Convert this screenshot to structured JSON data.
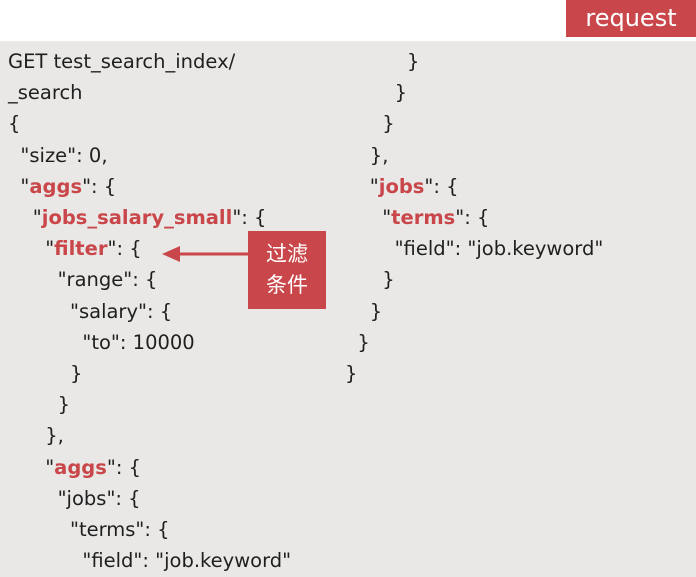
{
  "badge": "request",
  "callout": {
    "line1": "过滤",
    "line2": "条件"
  },
  "left_code": [
    [
      {
        "t": "GET test_search_index/"
      }
    ],
    [
      {
        "t": "_search"
      }
    ],
    [
      {
        "t": "{"
      }
    ],
    [
      {
        "t": "  \"size\": 0,"
      }
    ],
    [
      {
        "t": "  \""
      },
      {
        "t": "aggs",
        "k": true
      },
      {
        "t": "\": {"
      }
    ],
    [
      {
        "t": "    \""
      },
      {
        "t": "jobs_salary_small",
        "k": true
      },
      {
        "t": "\": {"
      }
    ],
    [
      {
        "t": "      \""
      },
      {
        "t": "filter",
        "k": true
      },
      {
        "t": "\": {"
      }
    ],
    [
      {
        "t": "        \"range\": {"
      }
    ],
    [
      {
        "t": "          \"salary\": {"
      }
    ],
    [
      {
        "t": "            \"to\": 10000"
      }
    ],
    [
      {
        "t": "          }"
      }
    ],
    [
      {
        "t": "        }"
      }
    ],
    [
      {
        "t": "      },"
      }
    ],
    [
      {
        "t": "      \""
      },
      {
        "t": "aggs",
        "k": true
      },
      {
        "t": "\": {"
      }
    ],
    [
      {
        "t": "        \"jobs\": {"
      }
    ],
    [
      {
        "t": "          \"terms\": {"
      }
    ],
    [
      {
        "t": "            \"field\": \"job.keyword\""
      }
    ]
  ],
  "right_code": [
    [
      {
        "t": "          }"
      }
    ],
    [
      {
        "t": "        }"
      }
    ],
    [
      {
        "t": "      }"
      }
    ],
    [
      {
        "t": "    },"
      }
    ],
    [
      {
        "t": "    \""
      },
      {
        "t": "jobs",
        "k": true
      },
      {
        "t": "\": {"
      }
    ],
    [
      {
        "t": "      \""
      },
      {
        "t": "terms",
        "k": true
      },
      {
        "t": "\": {"
      }
    ],
    [
      {
        "t": "        \"field\": \"job.keyword\""
      }
    ],
    [
      {
        "t": "      }"
      }
    ],
    [
      {
        "t": "    }"
      }
    ],
    [
      {
        "t": "  }"
      }
    ],
    [
      {
        "t": "}"
      }
    ]
  ],
  "colors": {
    "accent": "#c9474a",
    "panel": "#e9e8e6",
    "text": "#1f1f1f"
  }
}
